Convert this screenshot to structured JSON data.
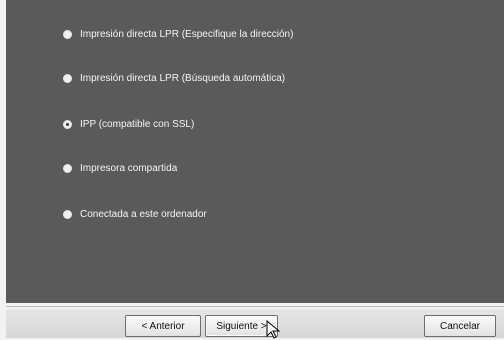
{
  "options": [
    {
      "label": "Impresión directa LPR (Especifique la dirección)",
      "selected": false
    },
    {
      "label": "Impresión directa LPR (Búsqueda automática)",
      "selected": false
    },
    {
      "label": "IPP (compatible con SSL)",
      "selected": true
    },
    {
      "label": "Impresora compartida",
      "selected": false
    },
    {
      "label": "Conectada a este ordenador",
      "selected": false
    }
  ],
  "buttons": {
    "back_label": "< Anterior",
    "next_label": "Siguiente >",
    "cancel_label": "Cancelar"
  },
  "colors": {
    "panel": "#5a5a5a",
    "option_text": "#f4f4f4"
  }
}
